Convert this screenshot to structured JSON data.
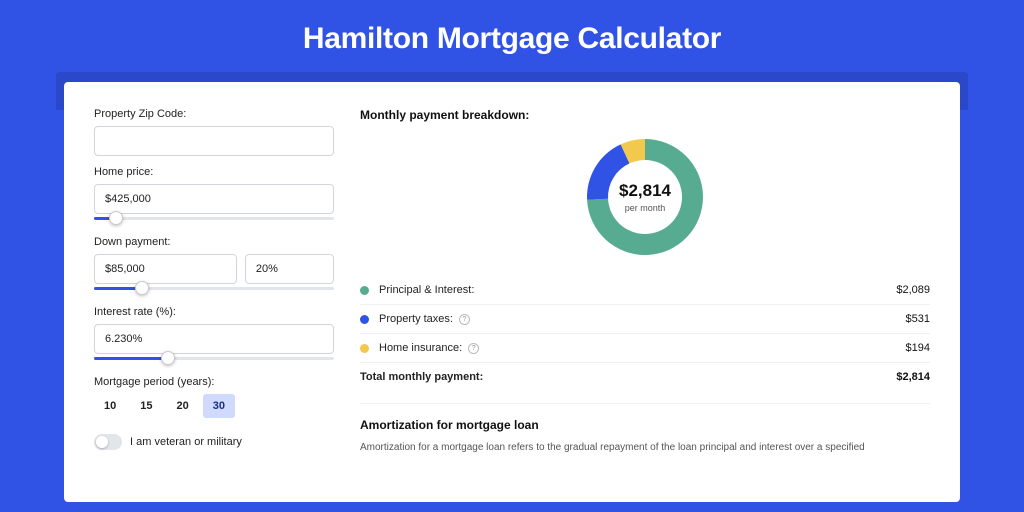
{
  "title": "Hamilton Mortgage Calculator",
  "colors": {
    "accent": "#3052e5",
    "series1": "#57ab90",
    "series2": "#3052e5",
    "series3": "#f2c94c"
  },
  "form": {
    "zip_label": "Property Zip Code:",
    "zip_value": "",
    "home_price_label": "Home price:",
    "home_price_value": "$425,000",
    "home_price_slider_pct": 9,
    "down_payment_label": "Down payment:",
    "down_payment_value": "$85,000",
    "down_payment_pct": "20%",
    "down_payment_slider_pct": 20,
    "interest_label": "Interest rate (%):",
    "interest_value": "6.230%",
    "interest_slider_pct": 31,
    "period_label": "Mortgage period (years):",
    "period_options": [
      "10",
      "15",
      "20",
      "30"
    ],
    "period_selected": "30",
    "veteran_label": "I am veteran or military",
    "veteran_on": false
  },
  "breakdown": {
    "title": "Monthly payment breakdown:",
    "center_amount": "$2,814",
    "center_freq": "per month",
    "items": [
      {
        "key": "principal",
        "name": "Principal & Interest:",
        "value": "$2,089",
        "num": 2089,
        "info": false
      },
      {
        "key": "taxes",
        "name": "Property taxes:",
        "value": "$531",
        "num": 531,
        "info": true
      },
      {
        "key": "insurance",
        "name": "Home insurance:",
        "value": "$194",
        "num": 194,
        "info": true
      }
    ],
    "total_label": "Total monthly payment:",
    "total_value": "$2,814"
  },
  "amortization": {
    "title": "Amortization for mortgage loan",
    "text": "Amortization for a mortgage loan refers to the gradual repayment of the loan principal and interest over a specified"
  },
  "chart_data": {
    "type": "pie",
    "title": "Monthly payment breakdown",
    "series": [
      {
        "name": "Principal & Interest",
        "value": 2089
      },
      {
        "name": "Property taxes",
        "value": 531
      },
      {
        "name": "Home insurance",
        "value": 194
      }
    ],
    "total": 2814,
    "unit": "USD"
  }
}
